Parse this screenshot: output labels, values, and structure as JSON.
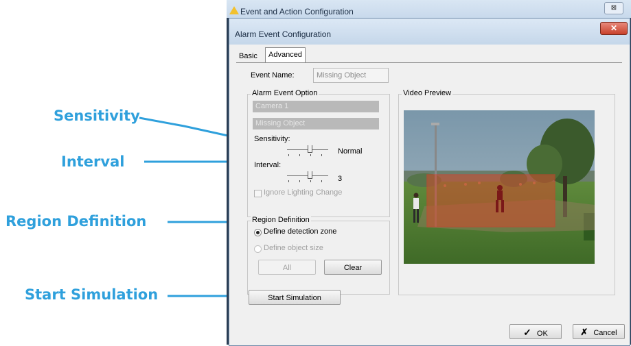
{
  "callouts": {
    "sensitivity": "Sensitivity",
    "interval": "Interval",
    "region_definition": "Region Definition",
    "start_simulation": "Start Simulation"
  },
  "back_window": {
    "title": "Event and Action Configuration",
    "close_glyph": "⊠"
  },
  "dialog": {
    "title": "Alarm Event Configuration",
    "close_glyph": "✕",
    "tabs": [
      "Basic",
      "Advanced"
    ],
    "active_tab": "Advanced",
    "event_name_label": "Event Name:",
    "event_name_value": "Missing Object",
    "alarm_event_option": {
      "title": "Alarm Event Option",
      "camera": "Camera 1",
      "event_type": "Missing Object",
      "sensitivity_label": "Sensitivity:",
      "sensitivity_value": "Normal",
      "interval_label": "Interval:",
      "interval_value": "3",
      "ignore_lighting_label": "Ignore Lighting Change"
    },
    "region_definition": {
      "title": "Region Definition",
      "option_zone": "Define detection zone",
      "option_size": "Define object size",
      "all_button": "All",
      "clear_button": "Clear"
    },
    "video_preview": {
      "title": "Video Preview"
    },
    "start_simulation_button": "Start Simulation",
    "ok_button": "OK",
    "cancel_button": "Cancel"
  },
  "colors": {
    "callout": "#2fa0dc",
    "detection_zone": "#d43a2e"
  }
}
